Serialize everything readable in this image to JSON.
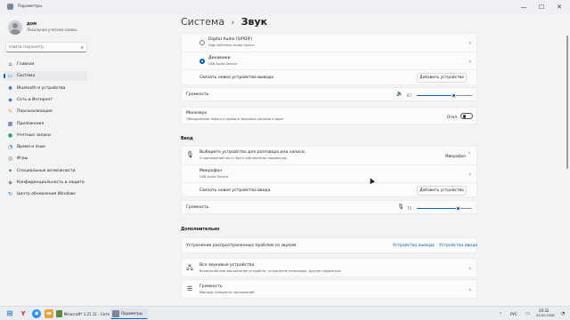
{
  "window": {
    "title": "Параметры",
    "minimize": "—",
    "maximize": "☐",
    "close": "✕"
  },
  "user": {
    "name": "дом",
    "account": "Локальная учетная запись"
  },
  "search": {
    "placeholder": "Найти параметр"
  },
  "nav": [
    {
      "id": "home",
      "label": "Главная",
      "icon": "⌂",
      "color": "#555"
    },
    {
      "id": "system",
      "label": "Система",
      "icon": "▭",
      "color": "#1f6fc4"
    },
    {
      "id": "bluetooth",
      "label": "Bluetooth и устройства",
      "icon": "✱",
      "color": "#1f6fc4"
    },
    {
      "id": "network",
      "label": "Сеть и Интернет",
      "icon": "◆",
      "color": "#3a7bd5"
    },
    {
      "id": "personalization",
      "label": "Персонализация",
      "icon": "✎",
      "color": "#d98b2b"
    },
    {
      "id": "apps",
      "label": "Приложения",
      "icon": "▦",
      "color": "#4a5fa8"
    },
    {
      "id": "accounts",
      "label": "Учетные записи",
      "icon": "●",
      "color": "#2fa36b"
    },
    {
      "id": "time",
      "label": "Время и язык",
      "icon": "◔",
      "color": "#2c7bd6"
    },
    {
      "id": "gaming",
      "label": "Игры",
      "icon": "◎",
      "color": "#666"
    },
    {
      "id": "accessibility",
      "label": "Специальные возможности",
      "icon": "✦",
      "color": "#1f6fc4"
    },
    {
      "id": "privacy",
      "label": "Конфиденциальность и защита",
      "icon": "◈",
      "color": "#666"
    },
    {
      "id": "update",
      "label": "Центр обновления Windows",
      "icon": "↻",
      "color": "#1f6fc4"
    }
  ],
  "breadcrumb": {
    "parent": "Система",
    "separator": "›",
    "current": "Звук"
  },
  "output": {
    "devices": [
      {
        "name": "Digital Audio (S/PDIF)",
        "sub": "High Definition Audio Device",
        "selected": false
      },
      {
        "name": "Динамики",
        "sub": "USB Audio Device",
        "selected": true
      }
    ],
    "pair_label": "Связать новое устройство вывода",
    "pair_button": "Добавить устройство",
    "volume_label": "Громкость",
    "volume_value": "67",
    "volume": 67,
    "mono_label": "Монозвук",
    "mono_desc": "Объединение левого и правого звуковых каналов в один",
    "mono_state": "Откл."
  },
  "input": {
    "section": "Ввод",
    "choose_label": "Выберите устройство для разговора или записи",
    "choose_desc": "У приложений могут быть собственные параметры",
    "choose_value": "Микрофон",
    "device_name": "Микрофон",
    "device_sub": "USB Audio Device",
    "pair_label": "Связать новое устройство ввода",
    "pair_button": "Добавить устройство",
    "volume_label": "Громкость",
    "volume_value": "75",
    "volume": 75
  },
  "advanced": {
    "section": "Дополнительно",
    "troubleshoot_label": "Устранение распространенных проблем со звуком",
    "troubleshoot_out": "Устройства вывода",
    "troubleshoot_in": "Устройства ввода",
    "all_devices_label": "Все звуковые устройства",
    "all_devices_desc": "Включение или выключение устройств, устранение неполадок, другие параметры",
    "volume_mixer_label": "Громкость",
    "volume_mixer_desc": "Микшер громкости приложений"
  },
  "taskbar": {
    "apps": [
      {
        "label": "Minecraft* 1.21.11 - Сете",
        "color": "#5a8a3a"
      },
      {
        "label": "Параметры",
        "color": "#7a8a9e"
      }
    ],
    "lang": "РУС",
    "time": "20:32",
    "date": "23.02.2026"
  },
  "colors": {
    "accent": "#005fb8",
    "background": "#f3f3f3",
    "card": "#fbfbfb"
  }
}
